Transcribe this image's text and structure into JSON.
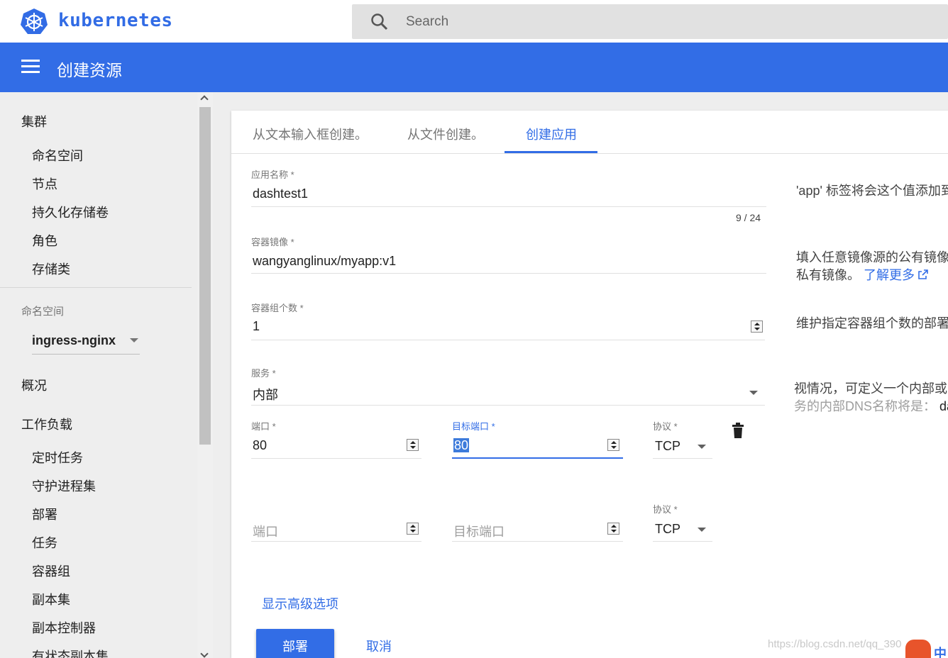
{
  "app": {
    "brand": "kubernetes",
    "search_placeholder": "Search"
  },
  "header": {
    "title": "创建资源"
  },
  "sidebar": {
    "cluster": {
      "title": "集群",
      "items": [
        "命名空间",
        "节点",
        "持久化存储卷",
        "角色",
        "存储类"
      ]
    },
    "namespace_label": "命名空间",
    "namespace_value": "ingress-nginx",
    "overview": "概况",
    "workloads": {
      "title": "工作负载",
      "items": [
        "定时任务",
        "守护进程集",
        "部署",
        "任务",
        "容器组",
        "副本集",
        "副本控制器",
        "有状态副本集"
      ]
    }
  },
  "tabs": [
    "从文本输入框创建。",
    "从文件创建。",
    "创建应用"
  ],
  "form": {
    "app_name": {
      "label": "应用名称 *",
      "value": "dashtest1",
      "counter": "9 / 24",
      "help": "'app' 标签将会这个值添加到"
    },
    "image": {
      "label": "容器镜像 *",
      "value": "wangyanglinux/myapp:v1",
      "help_line1": "填入任意镜像源的公有镜像",
      "help_line2": "私有镜像。",
      "learn_more": "了解更多"
    },
    "pods": {
      "label": "容器组个数 *",
      "value": "1",
      "help": "维护指定容器组个数的部署"
    },
    "service": {
      "label": "服务 *",
      "value": "内部",
      "help_line1": "视情况，可定义一个内部或",
      "help_line2": "务的内部DNS名称将是：",
      "help_suffix": "da"
    },
    "port_row1": {
      "port_label": "端口 *",
      "port_value": "80",
      "target_label": "目标端口 *",
      "target_value": "80",
      "protocol_label": "协议 *",
      "protocol_value": "TCP"
    },
    "port_row2": {
      "port_placeholder": "端口",
      "target_placeholder": "目标端口",
      "protocol_label": "协议 *",
      "protocol_value": "TCP"
    },
    "advanced": "显示高级选项",
    "deploy": "部署",
    "cancel": "取消"
  },
  "watermark": {
    "text": "https://blog.csdn.net/qq_390",
    "badge": "中"
  },
  "colors": {
    "primary": "#326de6",
    "brand": "#326ce5",
    "sidebar_bg": "#eeeeee"
  },
  "icons": [
    "kubernetes-logo-icon",
    "search-icon",
    "menu-icon",
    "chevron-up-icon",
    "chevron-down-icon",
    "dropdown-caret-icon",
    "external-link-icon",
    "trash-icon",
    "spinner-icon"
  ]
}
